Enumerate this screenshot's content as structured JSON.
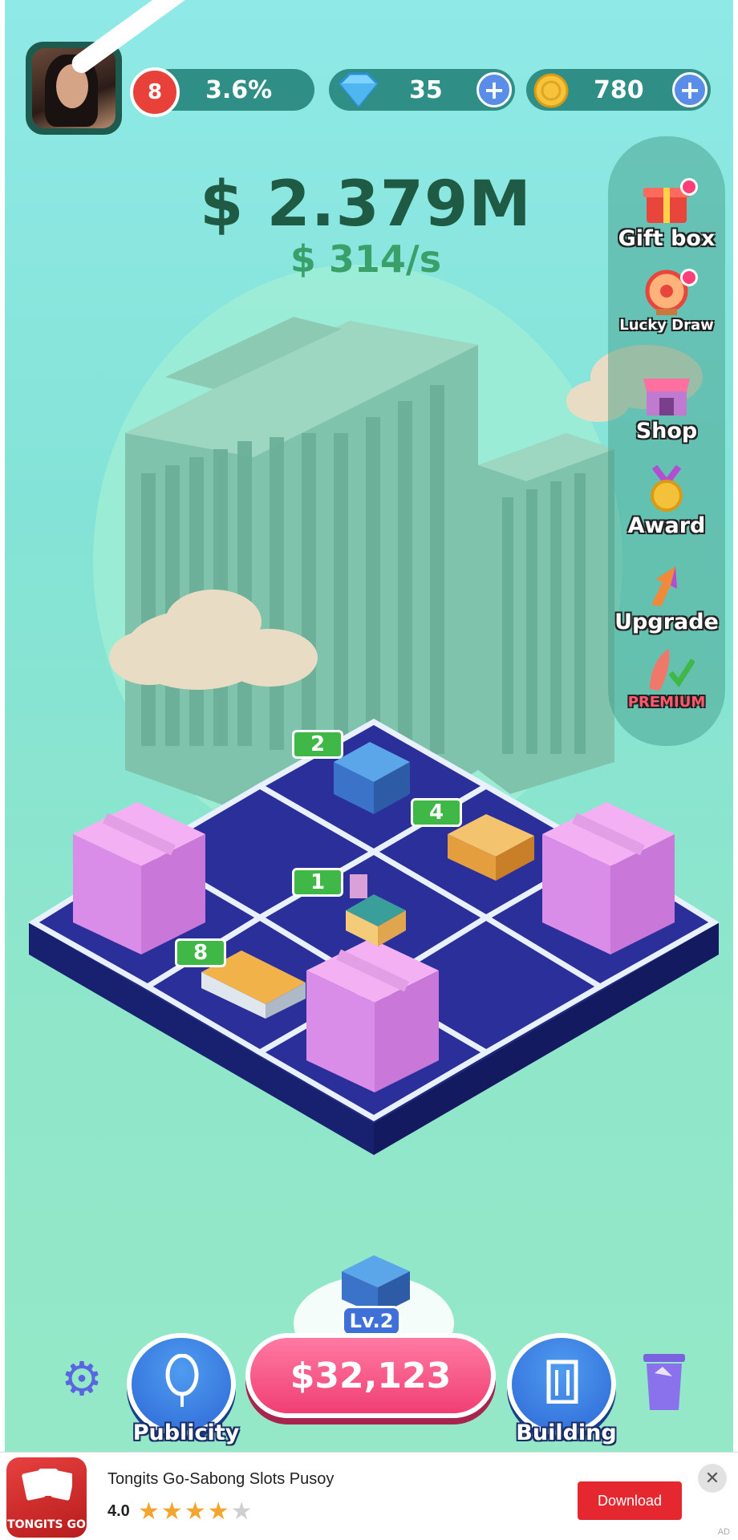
{
  "hud": {
    "level": "8",
    "progress_text": "3.6%",
    "gems": "35",
    "coins": "780"
  },
  "money": {
    "total": "$ 2.379M",
    "rate": "$ 314/s"
  },
  "side_menu": [
    {
      "label": "Gift box",
      "icon": "gift-box-icon",
      "has_dot": true
    },
    {
      "label": "Lucky Draw",
      "icon": "lucky-draw-icon",
      "has_dot": true
    },
    {
      "label": "Shop",
      "icon": "shop-icon",
      "has_dot": false
    },
    {
      "label": "Award",
      "icon": "award-medal-icon",
      "has_dot": false
    },
    {
      "label": "Upgrade",
      "icon": "upgrade-arrow-icon",
      "has_dot": false
    },
    {
      "label": "PREMIUM",
      "icon": "premium-rocket-icon",
      "has_dot": false
    }
  ],
  "board": {
    "buildings": [
      {
        "level": "2"
      },
      {
        "level": "4"
      },
      {
        "level": "1"
      },
      {
        "level": "8"
      }
    ]
  },
  "bottom": {
    "buy_price": "$32,123",
    "buy_level": "Lv.2",
    "publicity_label": "Publicity",
    "building_label": "Building"
  },
  "ad": {
    "logo_text": "TONGITS GO",
    "title": "Tongits Go-Sabong Slots Pusoy",
    "rating": "4.0",
    "stars": 4,
    "download_label": "Download",
    "close": "✕",
    "ad_mark": "AD"
  },
  "colors": {
    "background": "#8fe9e6",
    "money_total": "#1f5a45",
    "money_rate": "#3aa06a",
    "buy_button": "#f03f74",
    "round_button": "#2d68d6",
    "gift_box": "#d98de8",
    "tile": "#2a2f9a"
  }
}
